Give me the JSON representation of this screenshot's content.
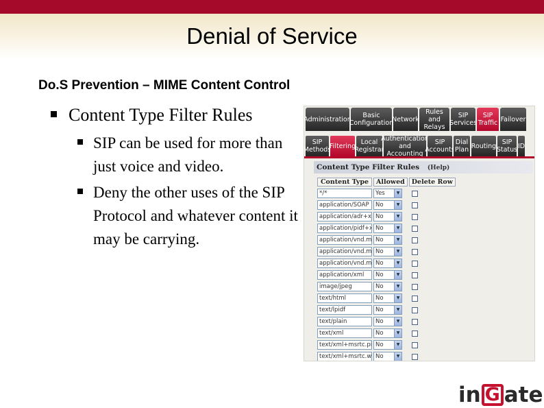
{
  "slide": {
    "title": "Denial of Service",
    "subtitle": "Do.S Prevention – MIME Content Control",
    "bullet_main": "Content Type Filter Rules",
    "sub_bullets": [
      "SIP can be used for more than just voice and video.",
      "Deny the other uses of the SIP Protocol and whatever content it may be carrying."
    ],
    "logo": {
      "left": "in",
      "mid": "G",
      "right": "ate"
    },
    "colors": {
      "band": "#a50a2a",
      "accent": "#c4122f"
    }
  },
  "screenshot": {
    "tabs_row1": [
      "Administration",
      "Basic\nConfiguration",
      "Network",
      "Rules and\nRelays",
      "SIP\nServices",
      "SIP\nTraffic",
      "Failover"
    ],
    "tabs_row1_active": 5,
    "tabs_row2": [
      "SIP\nMethods",
      "Filtering",
      "Local\nRegistrar",
      "Authentication\nand Accounting",
      "SIP\nAccounts",
      "Dial\nPlan",
      "Routing",
      "SIP\nStatus",
      "ID"
    ],
    "tabs_row2_active": 1,
    "panel_title": "Content Type Filter Rules",
    "help": "(Help)",
    "columns": [
      "Content Type",
      "Allowed",
      "Delete Row"
    ],
    "rows": [
      {
        "type": "*/*",
        "allowed": "Yes"
      },
      {
        "type": "application/SOAP",
        "allowed": "No"
      },
      {
        "type": "application/adr+xml",
        "allowed": "No"
      },
      {
        "type": "application/pidf+xml",
        "allowed": "No"
      },
      {
        "type": "application/vnd.m",
        "allowed": "No"
      },
      {
        "type": "application/vnd.m",
        "allowed": "No"
      },
      {
        "type": "application/vnd.m",
        "allowed": "No"
      },
      {
        "type": "application/xml",
        "allowed": "No"
      },
      {
        "type": "image/jpeg",
        "allowed": "No"
      },
      {
        "type": "text/html",
        "allowed": "No"
      },
      {
        "type": "text/lpidf",
        "allowed": "No"
      },
      {
        "type": "text/plain",
        "allowed": "No"
      },
      {
        "type": "text/xml",
        "allowed": "No"
      },
      {
        "type": "text/xml+msrtc.pi",
        "allowed": "No"
      },
      {
        "type": "text/xml+msrtc.w",
        "allowed": "No"
      }
    ]
  }
}
